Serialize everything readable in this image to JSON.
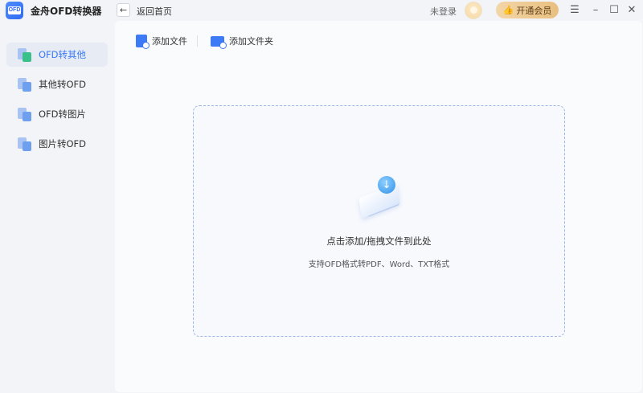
{
  "app": {
    "logo_text": "OFD",
    "title": "金舟OFD转换器"
  },
  "header": {
    "back_icon": "arrow-left-icon",
    "back_label": "返回首页",
    "login_label": "未登录",
    "vip_label": "开通会员",
    "vip_icon": "thumb-up-icon",
    "window_controls": [
      "menu-icon",
      "minimize-icon",
      "maximize-icon",
      "close-icon"
    ]
  },
  "sidebar": {
    "items": [
      {
        "label": "OFD转其他",
        "icon": "ofd-to-other-icon",
        "active": true
      },
      {
        "label": "其他转OFD",
        "icon": "other-to-ofd-icon",
        "active": false
      },
      {
        "label": "OFD转图片",
        "icon": "ofd-to-image-icon",
        "active": false
      },
      {
        "label": "图片转OFD",
        "icon": "image-to-ofd-icon",
        "active": false
      }
    ]
  },
  "toolbar": {
    "add_file_label": "添加文件",
    "add_folder_label": "添加文件夹"
  },
  "dropzone": {
    "title": "点击添加/拖拽文件到此处",
    "subtitle": "支持OFD格式转PDF、Word、TXT格式"
  },
  "colors": {
    "accent": "#3c7bf5",
    "vip_gradient_start": "#f3d6a8",
    "vip_gradient_end": "#e9bf80",
    "background": "#f2f4f8"
  }
}
